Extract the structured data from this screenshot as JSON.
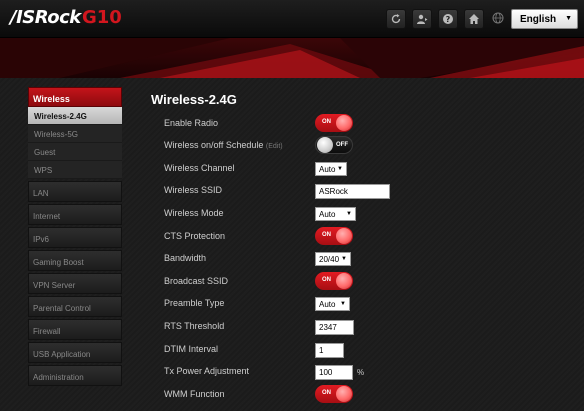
{
  "header": {
    "brand": "/ISRock",
    "model": "G10",
    "language": "English"
  },
  "icons": [
    "refresh-icon",
    "user-icon",
    "help-icon",
    "home-icon",
    "globe-icon"
  ],
  "colors": {
    "accent": "#d2161e",
    "toggle_on": "#e21b22"
  },
  "sidebar": {
    "section": "Wireless",
    "sub_items": [
      "Wireless-2.4G",
      "Wireless-5G",
      "Guest",
      "WPS"
    ],
    "active_sub": "Wireless-2.4G",
    "items": [
      "LAN",
      "Internet",
      "IPv6",
      "Gaming Boost",
      "VPN Server",
      "Parental Control",
      "Firewall",
      "USB Application",
      "Administration"
    ]
  },
  "page": {
    "title": "Wireless-2.4G",
    "on_label": "ON",
    "off_label": "OFF",
    "rows": {
      "enable_radio": {
        "label": "Enable Radio",
        "state": "ON"
      },
      "schedule": {
        "label": "Wireless on/off Schedule",
        "edit": "(Edit)",
        "state": "OFF"
      },
      "channel": {
        "label": "Wireless Channel",
        "value": "Auto"
      },
      "ssid": {
        "label": "Wireless SSID",
        "value": "ASRock"
      },
      "mode": {
        "label": "Wireless Mode",
        "value": "Auto"
      },
      "cts": {
        "label": "CTS Protection",
        "state": "ON"
      },
      "bandwidth": {
        "label": "Bandwidth",
        "value": "20/40"
      },
      "broadcast": {
        "label": "Broadcast SSID",
        "state": "ON"
      },
      "preamble": {
        "label": "Preamble Type",
        "value": "Auto"
      },
      "rts": {
        "label": "RTS Threshold",
        "value": "2347"
      },
      "dtim": {
        "label": "DTIM Interval",
        "value": "1"
      },
      "txpower": {
        "label": "Tx Power Adjustment",
        "value": "100",
        "unit": "%"
      },
      "wmm": {
        "label": "WMM Function",
        "state": "ON"
      }
    }
  }
}
